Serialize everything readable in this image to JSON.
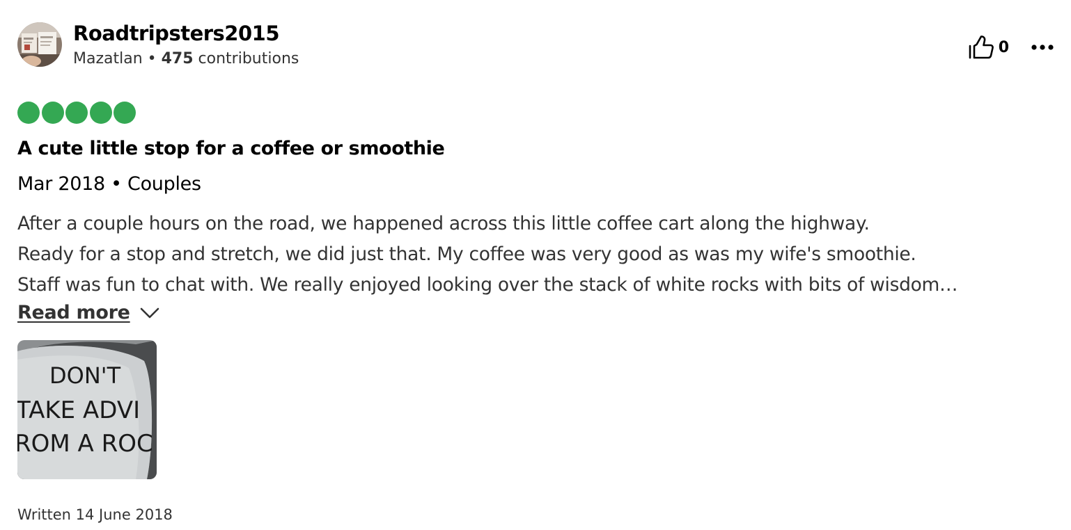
{
  "review": {
    "author": {
      "username": "Roadtripsters2015",
      "location": "Mazatlan",
      "separator": " • ",
      "contributions_count": "475",
      "contributions_label": " contributions",
      "avatar_icon": "user-avatar-photo"
    },
    "actions": {
      "like_count": "0",
      "like_icon": "thumbs-up-icon",
      "more_icon": "more-options-icon"
    },
    "rating": {
      "value": 5,
      "max": 5,
      "color": "#34a853"
    },
    "title": "A cute little stop for a coffee or smoothie",
    "trip_info": "Mar 2018 • Couples",
    "body_lines": [
      "After a couple hours on the road, we happened across this little coffee cart along the highway.",
      "Ready for a stop and stretch, we did just that. My coffee was very good as was my wife's smoothie.",
      "Staff was fun to chat with. We really enjoyed looking over the stack of white rocks with bits of wisdom…"
    ],
    "read_more_label": "Read more",
    "photo": {
      "lines": [
        "DON'T",
        "TAKE ADVI",
        "ROM A ROC"
      ]
    },
    "written_date": "Written 14 June 2018"
  }
}
